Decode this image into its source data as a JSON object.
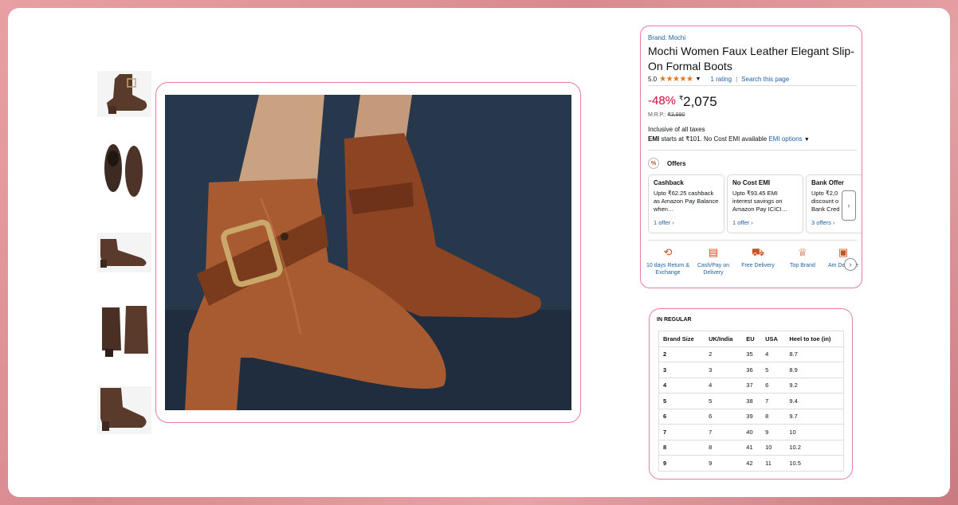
{
  "product": {
    "brand": "Brand: Mochi",
    "title": "Mochi Women Faux Leather Elegant Slip-On Formal Boots",
    "rating_value": "5.0",
    "rating_stars": "★★★★★",
    "rating_count": "1 rating",
    "search_page": "Search this page",
    "discount": "-48%",
    "currency": "₹",
    "price": "2,075",
    "mrp_label": "M.R.P.:",
    "mrp_value": "₹3,990",
    "taxes": "Inclusive of all taxes",
    "emi_bold": "EMI",
    "emi_text": "starts at ₹101. No Cost EMI available",
    "emi_link": "EMI options"
  },
  "offers": {
    "heading": "Offers",
    "icon_glyph": "%",
    "cards": [
      {
        "title": "Cashback",
        "body": "Upto ₹62.25 cashback as Amazon Pay Balance when…",
        "link": "1 offer ›"
      },
      {
        "title": "No Cost EMI",
        "body": "Upto ₹93.45 EMI interest savings on Amazon Pay ICICI…",
        "link": "1 offer ›"
      },
      {
        "title": "Bank Offer",
        "body": "Upto ₹2,0 discount o Bank Cred",
        "link": "3 offers ›"
      }
    ]
  },
  "features": [
    {
      "label": "10 days Return & Exchange",
      "icon": "return-icon",
      "glyph": "⟲"
    },
    {
      "label": "Cash/Pay on Delivery",
      "icon": "cash-icon",
      "glyph": "▤"
    },
    {
      "label": "Free Delivery",
      "icon": "truck-icon",
      "glyph": "⛟"
    },
    {
      "label": "Top Brand",
      "icon": "trophy-icon",
      "glyph": "♕"
    },
    {
      "label": "Am Delivere",
      "icon": "box-icon",
      "glyph": "▣"
    }
  ],
  "size_chart": {
    "title": "IN REGULAR",
    "headers": [
      "Brand Size",
      "UK/India",
      "EU",
      "USA",
      "Heel to toe (in)"
    ],
    "rows": [
      [
        "2",
        "2",
        "35",
        "4",
        "8.7"
      ],
      [
        "3",
        "3",
        "36",
        "5",
        "8.9"
      ],
      [
        "4",
        "4",
        "37",
        "6",
        "9.2"
      ],
      [
        "5",
        "5",
        "38",
        "7",
        "9.4"
      ],
      [
        "6",
        "6",
        "39",
        "8",
        "9.7"
      ],
      [
        "7",
        "7",
        "40",
        "9",
        "10"
      ],
      [
        "8",
        "8",
        "41",
        "10",
        "10.2"
      ],
      [
        "9",
        "9",
        "42",
        "11",
        "10.5"
      ]
    ]
  },
  "colors": {
    "accent_border": "#e97aa8",
    "link": "#2162a1",
    "discount": "#cc0c39",
    "star": "#de7921",
    "boot_brown": "#a05a30"
  }
}
